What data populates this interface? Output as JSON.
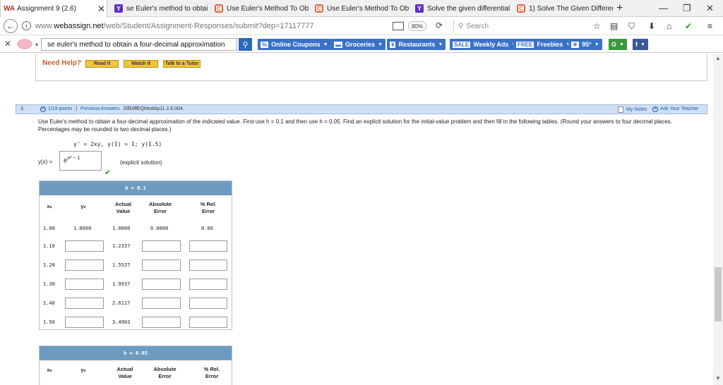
{
  "browser": {
    "tabs": [
      {
        "title": "Assignment 9 (2.6)",
        "icon": "webassign-icon",
        "close": "✕"
      },
      {
        "title": "se Euler's method to obtain",
        "icon": "yahoo-icon"
      },
      {
        "title": "Use Euler's Method To Obta",
        "icon": "chegg-icon"
      },
      {
        "title": "Use Euler's Method To Obta",
        "icon": "chegg-icon"
      },
      {
        "title": "Solve the given differential",
        "icon": "yahoo-icon"
      },
      {
        "title": "1) Solve The Given Different",
        "icon": "chegg-icon"
      }
    ],
    "new_tab": "+",
    "window_controls": [
      "—",
      "❐",
      "✕"
    ],
    "url_prefix": "www.",
    "url_domain": "webassign.net",
    "url_path": "/web/Student/Assignment-Responses/submit?dep=17117777",
    "zoom": "80%",
    "search_placeholder": "Search",
    "nav_icons": [
      "☆",
      "▤",
      "⛉",
      "⬇",
      "⌂",
      "✔",
      "≡"
    ]
  },
  "toolbar": {
    "search_value": "se euler's method to obtain a four-decimal approximation",
    "buttons": [
      {
        "label": "Online Coupons",
        "icon": "%"
      },
      {
        "label": "Groceries",
        "icon": "▬"
      },
      {
        "label": "Restaurants",
        "icon": "¥"
      },
      {
        "label": "Weekly Ads",
        "icon": "SALE"
      },
      {
        "label": "Freebies",
        "icon": "FREE"
      },
      {
        "label": "95°",
        "icon": "☀"
      }
    ]
  },
  "help": {
    "label": "Need Help?",
    "buttons": [
      "Read It",
      "Watch It",
      "Talk to a Tutor"
    ]
  },
  "question": {
    "number": "3.",
    "points": "1/19 points",
    "separator": "|",
    "previous": "Previous Answers",
    "code": "ZillDiffEQModAp11 2.6.004.",
    "my_notes": "My Notes",
    "ask": "Ask Your Teacher",
    "instructions": "Use Euler's method to obtain a four-decimal approximation of the indicated value. First use h = 0.1 and then use h = 0.05. Find an explicit solution for the initial-value problem and then fill in the following tables. (Round your answers to four decimal places. Percentages may be rounded to two decimal places.)",
    "equation": "y' = 2xy,   y(1) = 1; y(1.5)",
    "yx_label": "y(x) =",
    "yx_value_base": "e",
    "yx_value_exp": "x² − 1",
    "explicit_note": "(explicit solution)"
  },
  "table1": {
    "title": "h = 0.1",
    "headers": {
      "xn": "xₙ",
      "yn": "yₙ",
      "actual": "Actual\nValue",
      "abs": "Absolute\nError",
      "rel": "% Rel.\nError"
    },
    "rows": [
      {
        "x": "1.00",
        "y": "1.0000",
        "actual": "1.0000",
        "abs": "0.0000",
        "rel": "0.00"
      },
      {
        "x": "1.10",
        "actual": "1.2337"
      },
      {
        "x": "1.20",
        "actual": "1.5527"
      },
      {
        "x": "1.30",
        "actual": "1.9937"
      },
      {
        "x": "1.40",
        "actual": "2.6117"
      },
      {
        "x": "1.50",
        "actual": "3.4903"
      }
    ]
  },
  "table2": {
    "title": "h = 0.05",
    "headers": {
      "xn": "xₙ",
      "yn": "yₙ",
      "actual": "Actual\nValue",
      "abs": "Absolute\nError",
      "rel": "% Rel.\nError"
    }
  }
}
